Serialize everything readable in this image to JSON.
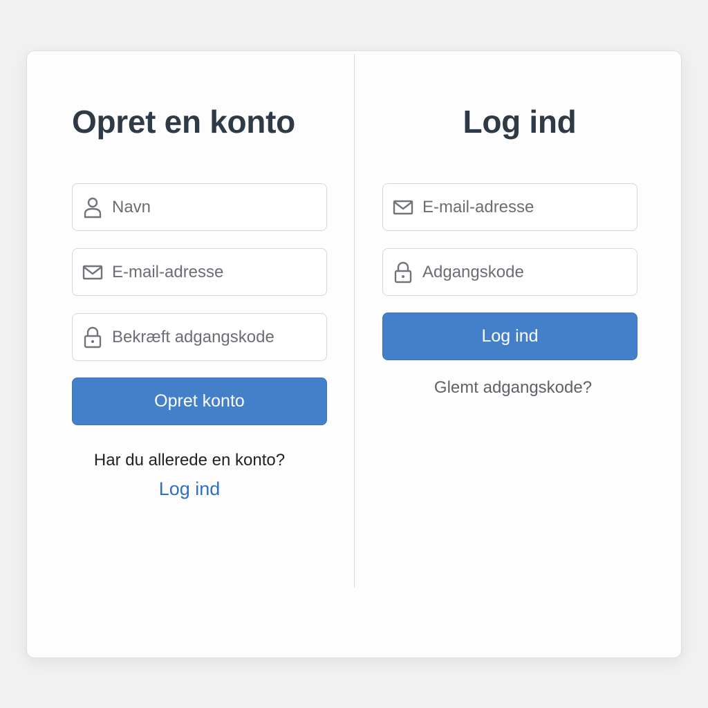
{
  "signup": {
    "title": "Opret en konto",
    "name_placeholder": "Navn",
    "email_placeholder": "E-mail-adresse",
    "password_placeholder": "Bekræft adgangskode",
    "submit_label": "Opret konto",
    "prompt": "Har du allerede en konto?",
    "login_link": "Log ind"
  },
  "login": {
    "title": "Log ind",
    "email_placeholder": "E-mail-adresse",
    "password_placeholder": "Adgangskode",
    "submit_label": "Log ind",
    "forgot_link": "Glemt adgangskode?"
  },
  "icons": {
    "name": "person-icon",
    "email": "envelope-icon",
    "password": "lock-icon"
  },
  "colors": {
    "primary": "#4380c9",
    "link": "#2f6fbe",
    "heading": "#2f3a47"
  }
}
